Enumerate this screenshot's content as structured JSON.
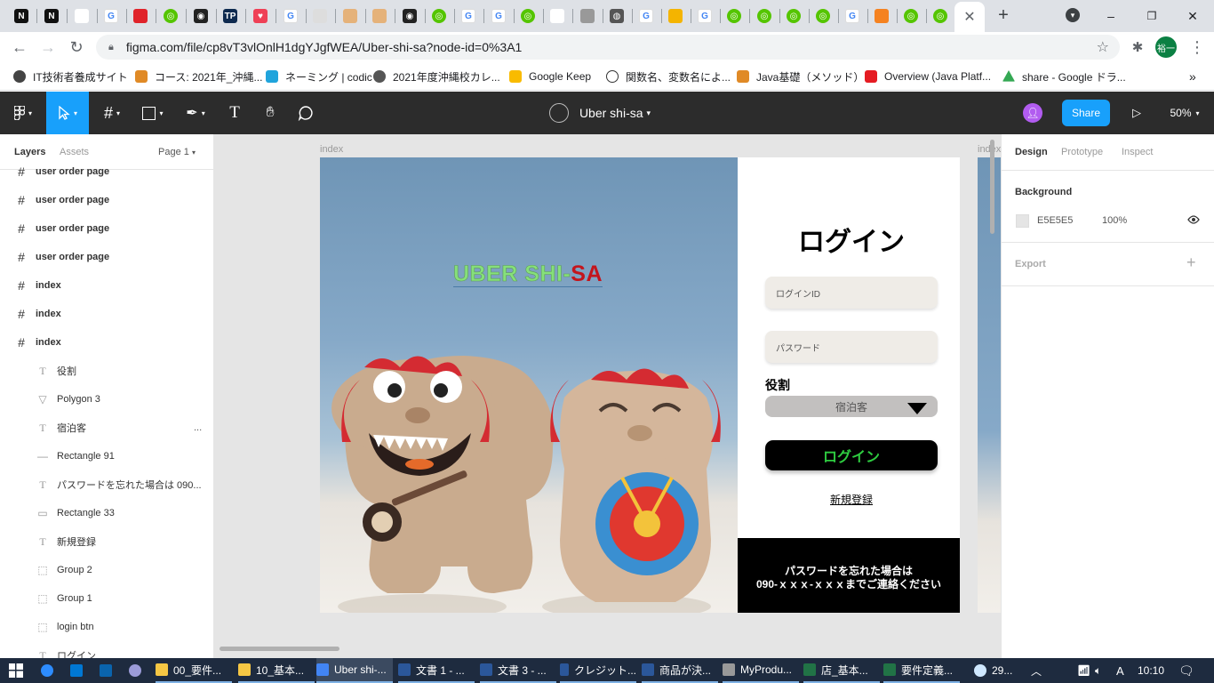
{
  "browser": {
    "tabs_icons": [
      "notion-icon",
      "notion-icon",
      "vscode-icon",
      "google-icon",
      "oracle-icon",
      "qiita-icon",
      "github-icon",
      "techpit-icon",
      "pocket-icon",
      "google-icon",
      "doc-icon",
      "avatar-icon",
      "avatar-icon",
      "github-icon",
      "qiita-icon",
      "google-icon",
      "google-icon",
      "qiita-icon",
      "bracket-icon",
      "meet-icon",
      "rss-icon",
      "google-icon",
      "clap-icon",
      "google-icon",
      "qiita-icon",
      "qiita-icon",
      "qiita-icon",
      "qiita-icon",
      "google-icon",
      "lancers-icon",
      "qiita-icon",
      "qiita-icon"
    ],
    "url": "figma.com/file/cp8vT3vlOnlH1dgYJgfWEA/Uber-shi-sa?node-id=0%3A1",
    "profile_label": "裕一",
    "bookmarks": [
      "IT技術者養成サイト",
      "コース: 2021年_沖縄...",
      "ネーミング | codic",
      "2021年度沖縄校カレ...",
      "Google Keep",
      "関数名、変数名によ...",
      "Java基礎（メソッド）",
      "Overview (Java Platf...",
      "share - Google ドラ..."
    ],
    "bookmark_overflow": "»"
  },
  "figma": {
    "file_title": "Uber shi-sa",
    "share_label": "Share",
    "zoom": "50%",
    "left_tabs": {
      "layers": "Layers",
      "assets": "Assets",
      "page": "Page 1"
    },
    "layers": [
      {
        "name": "user order page",
        "type": "frame",
        "indent": 0
      },
      {
        "name": "user order page",
        "type": "frame",
        "indent": 0
      },
      {
        "name": "user order page",
        "type": "frame",
        "indent": 0
      },
      {
        "name": "user order page",
        "type": "frame",
        "indent": 0
      },
      {
        "name": "index",
        "type": "frame",
        "indent": 0
      },
      {
        "name": "index",
        "type": "frame",
        "indent": 0
      },
      {
        "name": "index",
        "type": "frame",
        "indent": 0
      },
      {
        "name": "役割",
        "type": "text",
        "indent": 1
      },
      {
        "name": "Polygon 3",
        "type": "polygon",
        "indent": 1
      },
      {
        "name": "宿泊客",
        "type": "text",
        "indent": 1
      },
      {
        "name": "Rectangle 91",
        "type": "line",
        "indent": 1
      },
      {
        "name": "パスワードを忘れた場合は 090...",
        "type": "text",
        "indent": 1
      },
      {
        "name": "Rectangle 33",
        "type": "rect",
        "indent": 1
      },
      {
        "name": "新規登録",
        "type": "text",
        "indent": 1
      },
      {
        "name": "Group 2",
        "type": "group",
        "indent": 1
      },
      {
        "name": "Group 1",
        "type": "group",
        "indent": 1
      },
      {
        "name": "login btn",
        "type": "group",
        "indent": 1
      },
      {
        "name": "ログイン",
        "type": "text",
        "indent": 1
      }
    ],
    "layer_more": "...",
    "canvas": {
      "frame_label": "index",
      "frame_label_2": "index",
      "brand": {
        "part1": "UBER SHI-",
        "part2": "SA"
      },
      "login_title": "ログイン",
      "login_id_placeholder": "ログインID",
      "password_placeholder": "パスワード",
      "role_label": "役割",
      "role_value": "宿泊客",
      "login_button": "ログイン",
      "register_link": "新規登録",
      "forgot_line1": "パスワードを忘れた場合は",
      "forgot_line2": "090-ｘｘｘ-ｘｘｘまでご連絡ください"
    },
    "right_tabs": {
      "design": "Design",
      "prototype": "Prototype",
      "inspect": "Inspect"
    },
    "background": {
      "label": "Background",
      "hex": "E5E5E5",
      "opacity": "100%"
    },
    "export_label": "Export",
    "help": "?"
  },
  "taskbar": {
    "items": [
      "00_要件...",
      "10_基本...",
      "Uber shi-...",
      "文書 1 - ...",
      "文書 3 - ...",
      "クレジット...",
      "商品が決...",
      "MyProdu...",
      "店_基本...",
      "要件定義..."
    ],
    "weather": "29...",
    "ime": "A",
    "time": "10:10"
  },
  "colors": {
    "figma_blue": "#18a0fb",
    "brand_green": "#7bd37b",
    "brand_red": "#c4151c",
    "login_green": "#2ecc40"
  }
}
